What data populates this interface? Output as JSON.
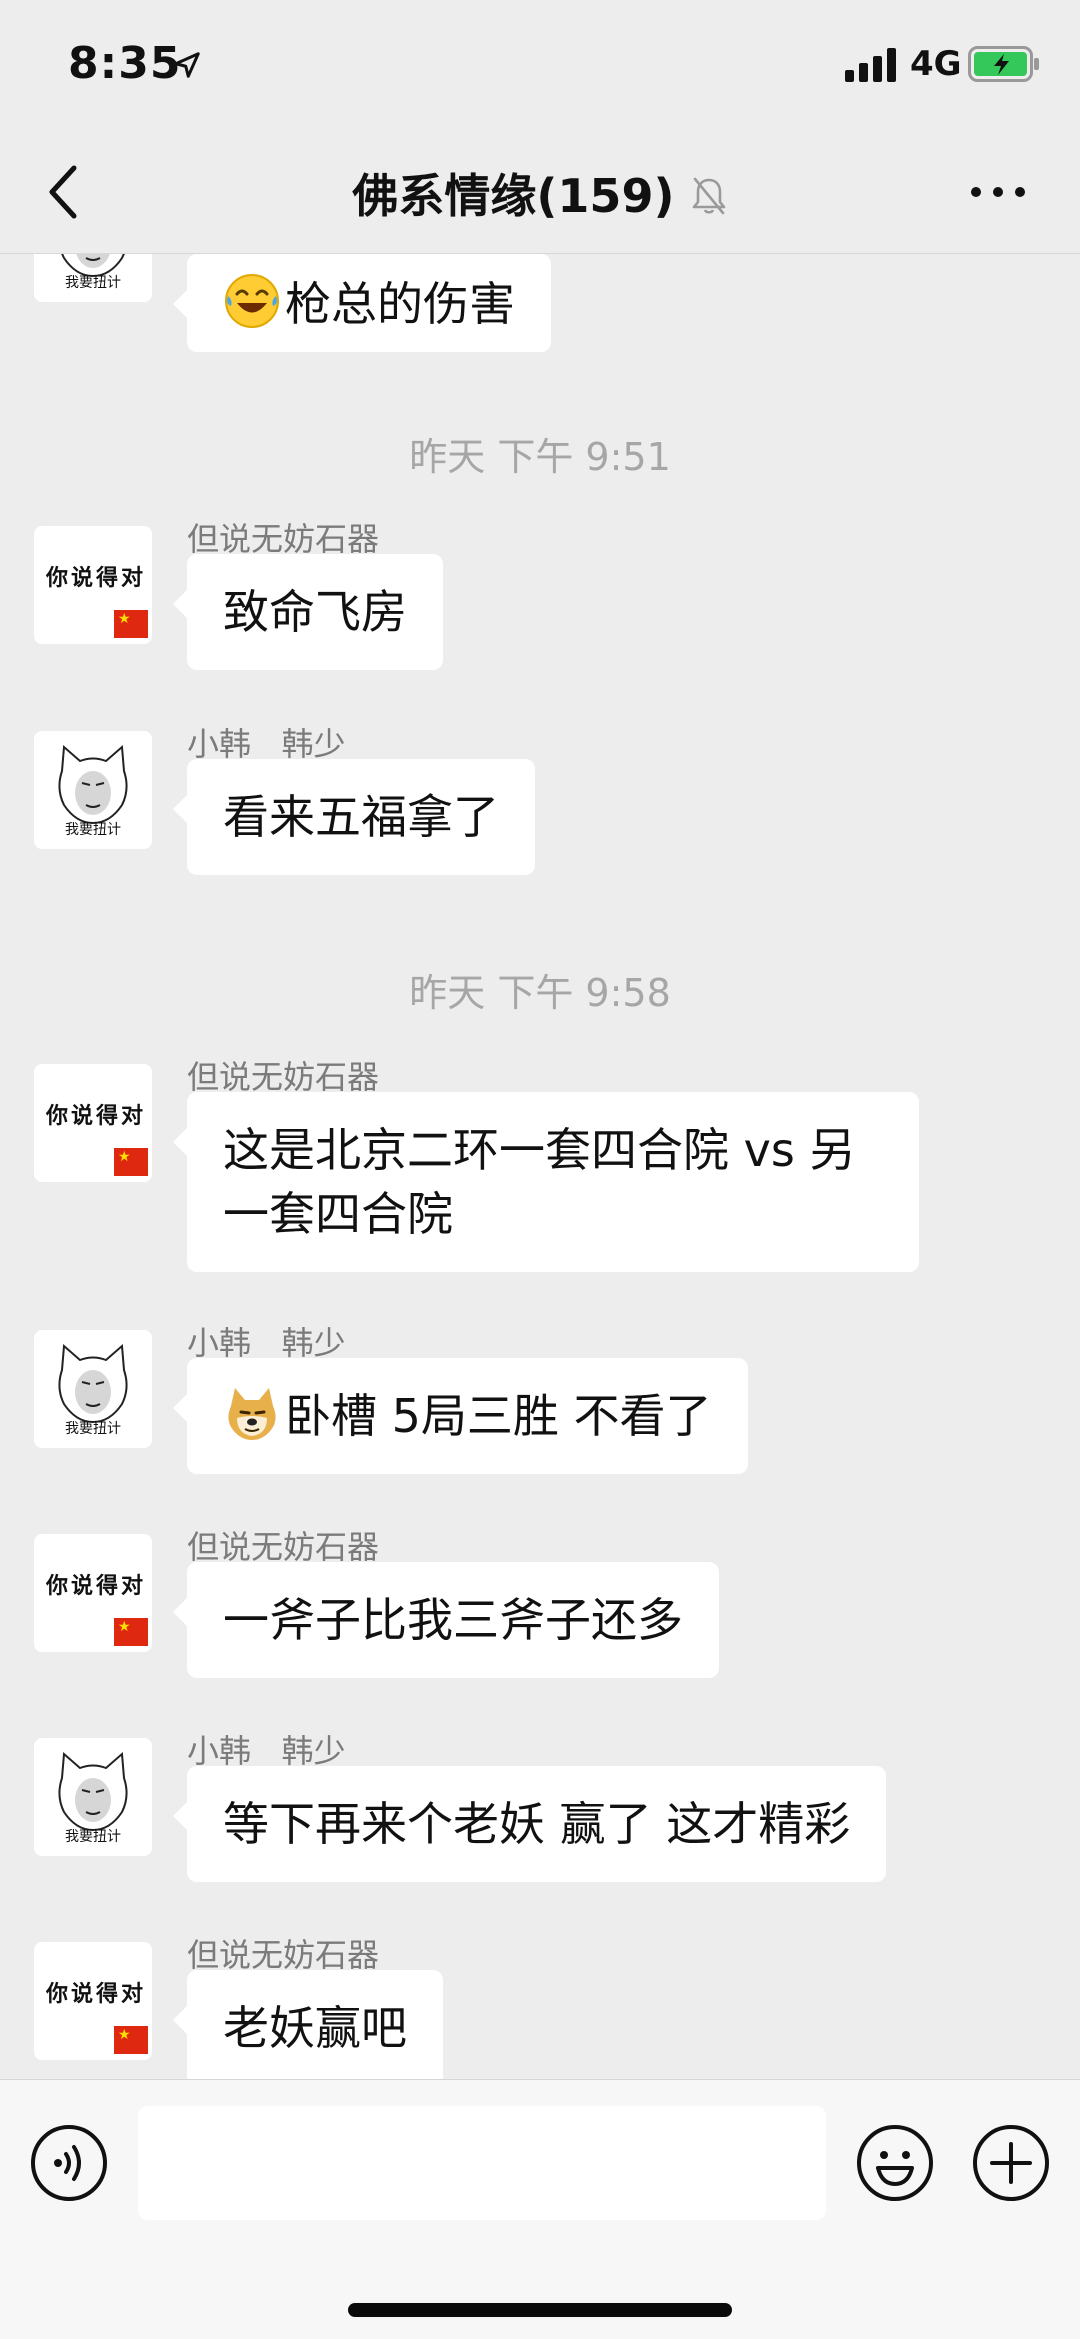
{
  "status_bar": {
    "time": "8:35",
    "network": "4G",
    "location_icon": "location-arrow-icon",
    "battery_color": "#34c759"
  },
  "nav": {
    "title": "佛系情缘(159)",
    "back_icon": "chevron-left-icon",
    "mute_icon": "bell-slash-icon",
    "more_icon": "more-dots-icon"
  },
  "avatars": {
    "a_text": "你说得对",
    "b_caption": "我要扭计"
  },
  "messages": {
    "m0": {
      "text": "枪总的伤害",
      "emoji": "laughing-tears-emoji"
    },
    "t1": "昨天 下午 9:51",
    "m1": {
      "sender": "但说无妨石器",
      "text": "致命飞房"
    },
    "m2": {
      "sender": "小韩   韩少",
      "text": "看来五福拿了"
    },
    "t2": "昨天 下午 9:58",
    "m3": {
      "sender": "但说无妨石器",
      "line1": "这是北京二环一套四合院 vs 另",
      "line2": "一套四合院"
    },
    "m4": {
      "sender": "小韩   韩少",
      "text": "卧槽 5局三胜 不看了",
      "emoji": "doge-emoji"
    },
    "m5": {
      "sender": "但说无妨石器",
      "text": "一斧子比我三斧子还多"
    },
    "m6": {
      "sender": "小韩   韩少",
      "text": "等下再来个老妖 赢了 这才精彩"
    },
    "m7": {
      "sender": "但说无妨石器",
      "text": "老妖赢吧"
    }
  },
  "input_bar": {
    "placeholder": "",
    "voice_icon": "voice-icon",
    "emoji_icon": "emoji-icon",
    "plus_icon": "plus-icon"
  }
}
